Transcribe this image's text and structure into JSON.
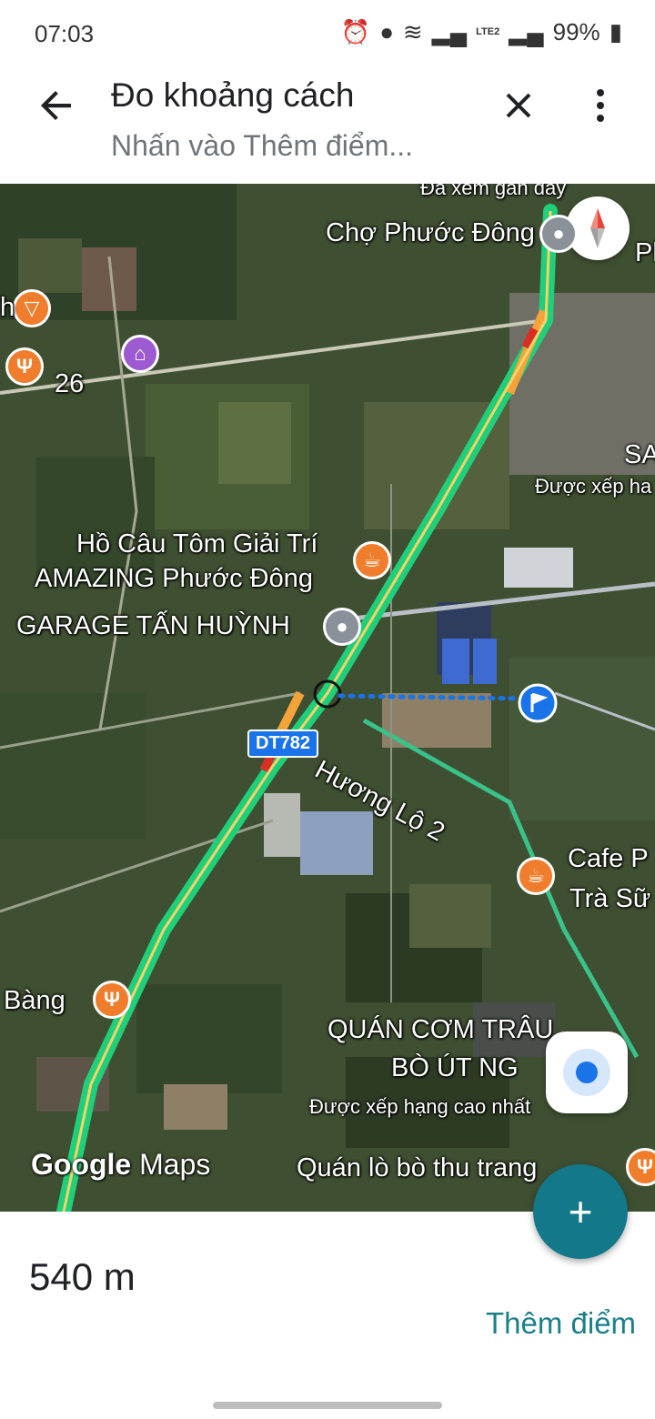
{
  "status_bar": {
    "time": "07:03",
    "network": "LTE2",
    "battery": "99%"
  },
  "app_bar": {
    "title": "Đo khoảng cách",
    "subtitle": "Nhấn vào Thêm điểm...",
    "icons": [
      "arrow-back-icon",
      "close-icon",
      "more-vert-icon"
    ]
  },
  "map": {
    "labels": {
      "cho_phuoc_dong": "Chợ Phước Đông",
      "recent_cut": "Đã xem gần đây",
      "road_26": "26",
      "ho_cau_1": "Hồ Câu Tôm Giải Trí",
      "ho_cau_2": "AMAZING Phước Đông",
      "garage": "GARAGE TẤN HUỲNH",
      "route": "DT782",
      "huong_lo": "Hương Lộ 2",
      "cafe_1": "Cafe P",
      "cafe_2": "Trà Sữ",
      "bang": "Bàng",
      "quan_com_1": "QUÁN CƠM TRÂU",
      "quan_com_2": "BÒ ÚT NG",
      "rated_high": "Được xếp hạng cao nhất",
      "rated_right": "Được xếp ha",
      "sa": "SA",
      "ph": "Ph",
      "quan_lo_bo": "Quán lò bò thu trang",
      "h_left": "h"
    },
    "watermark": {
      "google": "Google",
      "maps": "Maps"
    },
    "colors": {
      "traffic_green": "#1fcf7a",
      "traffic_orange": "#f2a33a",
      "traffic_red": "#d93025",
      "measure_line": "#1a73e8"
    }
  },
  "fab": {
    "label": "+"
  },
  "panel": {
    "distance": "540 m",
    "add_point": "Thêm điểm"
  }
}
